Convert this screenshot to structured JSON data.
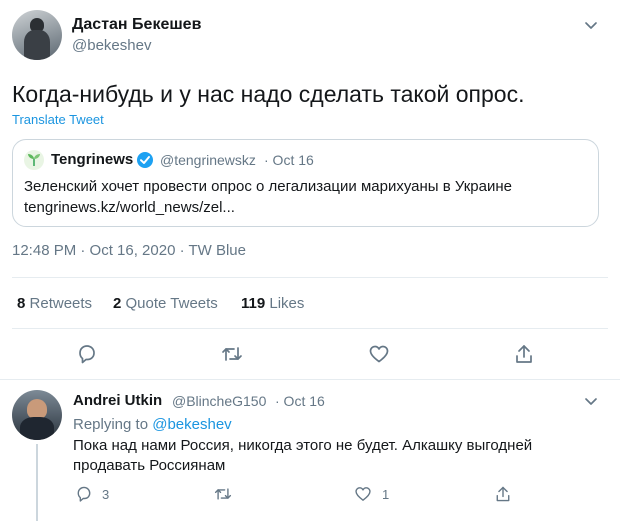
{
  "tweet": {
    "author_name": "Дастан Бекешев",
    "author_handle": "@bekeshev",
    "text": "Когда-нибудь и у нас надо сделать такой опрос.",
    "translate_label": "Translate Tweet",
    "timestamp": "12:48 PM · Oct 16, 2020 · TW Blue",
    "more_icon": "chevron-down-icon"
  },
  "quoted": {
    "name": "Tengrinews",
    "handle": "@tengrinewskz",
    "date": "· Oct 16",
    "text": "Зеленский хочет провести опрос о легализации марихуаны в Украине",
    "link": "tengrinews.kz/world_news/zel..."
  },
  "stats": {
    "retweets_count": "8",
    "retweets_label": "Retweets",
    "quotes_count": "2",
    "quotes_label": "Quote Tweets",
    "likes_count": "119",
    "likes_label": "Likes"
  },
  "actions": [
    "reply-icon",
    "retweet-icon",
    "like-icon",
    "share-icon"
  ],
  "reply": {
    "author_name": "Andrei Utkin",
    "author_handle": "@BlincheG150",
    "date": "· Oct 16",
    "replying_prefix": "Replying to",
    "replying_to": "@bekeshev",
    "text_line1": "Пока над нами Россия, никогда этого не будет. Алкашку выгодней",
    "text_line2": "продавать Россиянам",
    "reply_count": "3",
    "like_count": "1"
  },
  "colors": {
    "link": "#1b95e0",
    "muted": "#657786",
    "border": "#ccd6dd",
    "verified": "#1da1f2"
  }
}
